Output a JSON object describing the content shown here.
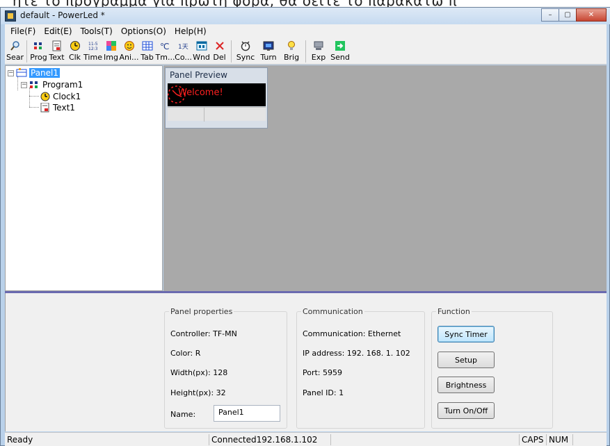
{
  "caption_fragment": "ητε το πρόγραμμα για πρώτη φορά, θα δείτε το παρακάτω π",
  "window": {
    "title": "default - PowerLed *",
    "controls": {
      "minimize": "–",
      "maximize": "▢",
      "close": "✕"
    }
  },
  "menu": [
    "File(F)",
    "Edit(E)",
    "Tools(T)",
    "Options(O)",
    "Help(H)"
  ],
  "toolbar": [
    {
      "label": "Sear",
      "icon": "search-icon"
    },
    {
      "label": "Prog",
      "icon": "program-icon"
    },
    {
      "label": "Text",
      "icon": "text-icon"
    },
    {
      "label": "Clk",
      "icon": "clock-icon"
    },
    {
      "label": "Time",
      "icon": "time-icon"
    },
    {
      "label": "Img",
      "icon": "image-icon"
    },
    {
      "label": "Ani...",
      "icon": "animation-icon"
    },
    {
      "label": "Tab",
      "icon": "table-icon"
    },
    {
      "label": "Tm...",
      "icon": "temperature-icon"
    },
    {
      "label": "Co...",
      "icon": "counter-icon"
    },
    {
      "label": "Wnd",
      "icon": "window-icon"
    },
    {
      "label": "Del",
      "icon": "delete-icon"
    },
    {
      "label": "Sync",
      "icon": "sync-icon"
    },
    {
      "label": "Turn",
      "icon": "turn-icon"
    },
    {
      "label": "Brig",
      "icon": "brightness-icon"
    },
    {
      "label": "Exp",
      "icon": "export-icon"
    },
    {
      "label": "Send",
      "icon": "send-icon"
    }
  ],
  "tree": {
    "panel": "Panel1",
    "program": "Program1",
    "children": [
      "Clock1",
      "Text1"
    ]
  },
  "preview": {
    "title": "Panel Preview",
    "led_text": "Welcome!",
    "led_color": "#ff2020"
  },
  "panel_properties": {
    "title": "Panel properties",
    "controller": "Controller: TF-MN",
    "color": "Color: R",
    "width": "Width(px): 128",
    "height": "Height(px): 32",
    "name_label": "Name:",
    "name_value": "Panel1"
  },
  "communication": {
    "title": "Communication",
    "type": "Communication: Ethernet",
    "ip": "IP address: 192. 168. 1. 102",
    "port": "Port: 5959",
    "panel_id": "Panel ID: 1"
  },
  "function": {
    "title": "Function",
    "buttons": [
      "Sync Timer",
      "Setup",
      "Brightness",
      "Turn On/Off"
    ]
  },
  "status": {
    "state": "Ready",
    "connection": "Connected192.168.1.102",
    "caps": "CAPS",
    "num": "NUM"
  }
}
